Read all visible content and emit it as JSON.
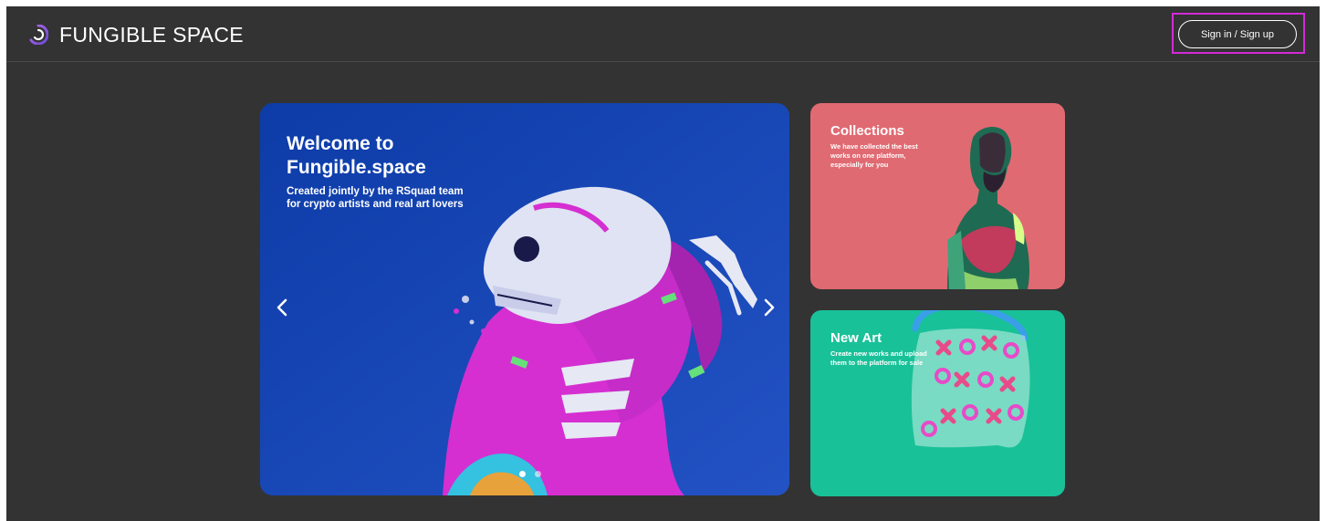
{
  "header": {
    "logo_text": "FUNGIBLE SPACE",
    "logo_icon": "fungible-space-logo-icon",
    "signin_label": "Sign in / Sign up"
  },
  "hero": {
    "title": "Welcome to Fungible.space",
    "subtitle": "Created jointly by the RSquad team for crypto artists and real art lovers",
    "prev_icon": "chevron-left-icon",
    "next_icon": "chevron-right-icon",
    "slide_count": 2,
    "active_slide": 1
  },
  "cards": {
    "collections": {
      "title": "Collections",
      "subtitle": "We have collected the best works on one platform, especially for you"
    },
    "new_art": {
      "title": "New Art",
      "subtitle": "Create new works and upload them to the platform for sale"
    }
  },
  "colors": {
    "background": "#333333",
    "hero": "#1c46b4",
    "collections_card": "#e06a72",
    "new_art_card": "#19c199",
    "accent_magenta": "#d42ad8",
    "logo_purple": "#9b5ddc"
  }
}
